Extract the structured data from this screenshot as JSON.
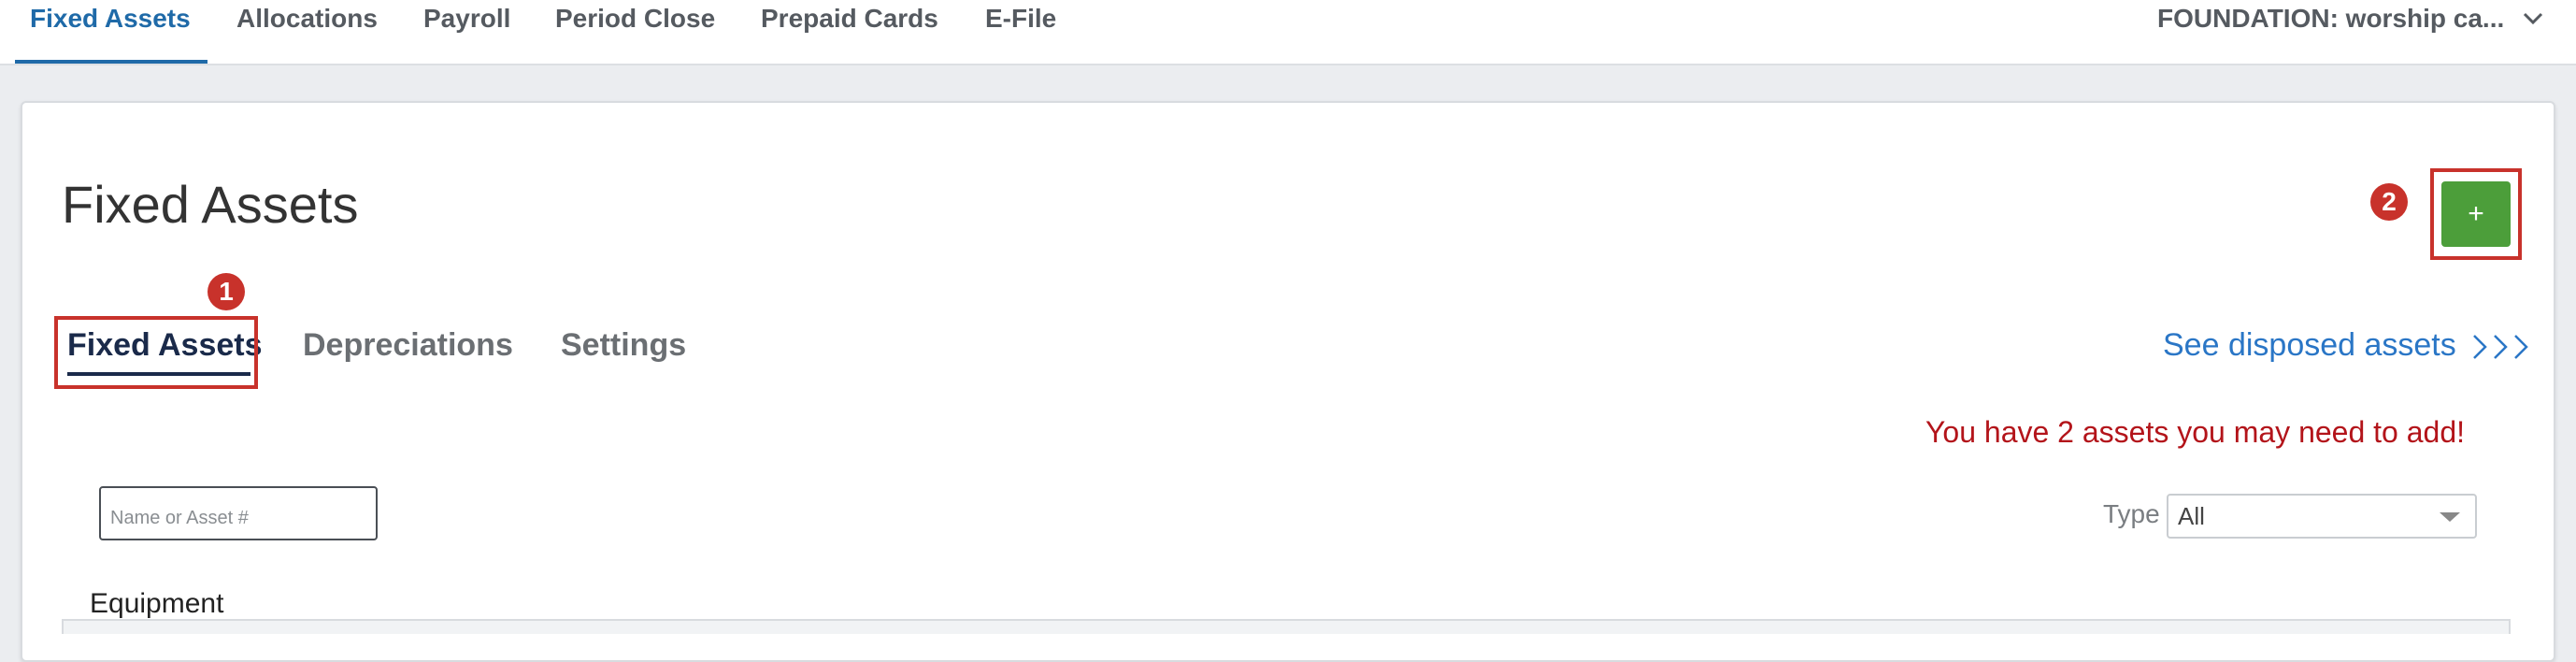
{
  "topnav": {
    "tabs": [
      "Fixed Assets",
      "Allocations",
      "Payroll",
      "Period Close",
      "Prepaid Cards",
      "E-File"
    ],
    "active_tab": "Fixed Assets",
    "org_selector": "FOUNDATION: worship ca...",
    "org_icon": "chevron-down-icon"
  },
  "page": {
    "title": "Fixed Assets",
    "add_button": "+",
    "subtabs": [
      "Fixed Assets",
      "Depreciations",
      "Settings"
    ],
    "active_subtab": "Fixed Assets",
    "disposed_link": "See disposed assets",
    "notice": "You have 2 assets you may need to add!",
    "search_placeholder": "Name or Asset #",
    "type_label": "Type",
    "type_value": "All",
    "section": "Equipment"
  },
  "annotations": {
    "badge_1": "1",
    "badge_2": "2",
    "color": "#c8322b"
  },
  "colors": {
    "accent": "#1f6aa8",
    "add_button": "#4c9e3a",
    "notice": "#b3141a",
    "link": "#2a76c6"
  }
}
